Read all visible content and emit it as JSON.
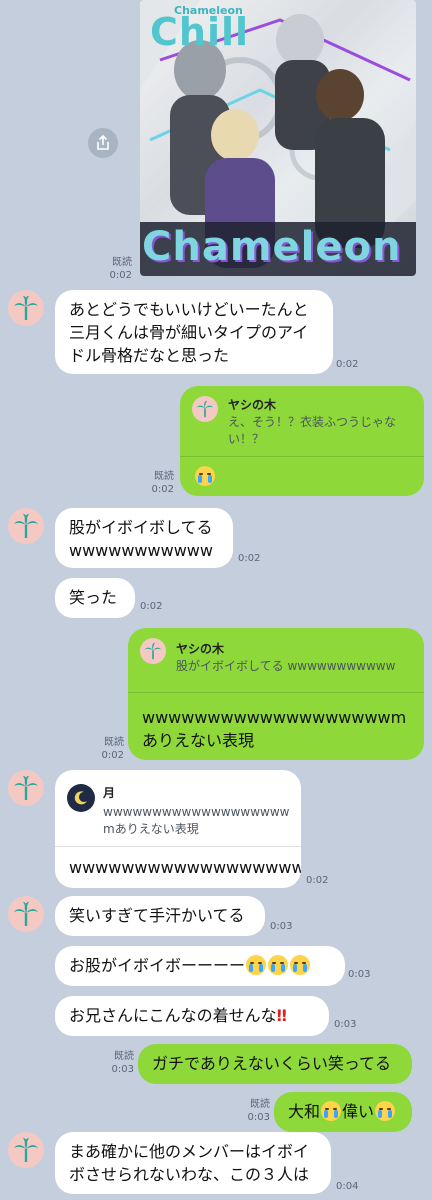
{
  "album": {
    "subtitle": "Chameleon",
    "title": "Chill",
    "bottom_text": "Chameleon",
    "read": "既読",
    "time": "0:02"
  },
  "share_icon": "share-icon",
  "messages": [
    {
      "text_lines": [
        "あとどうでもいいけどいーたんと",
        "三月くんは骨が細いタイプのアイ",
        "ドル骨格だなと思った"
      ],
      "time": "0:02"
    },
    {
      "reply_name": "ヤシの木",
      "reply_quote": [
        "え、そう！？衣装ふつうじゃな",
        "い！？"
      ],
      "read": "既読",
      "time": "0:02"
    },
    {
      "text_lines": [
        "股がイボイボしてる",
        "wwwwwwwwwww"
      ],
      "time": "0:02"
    },
    {
      "text": "笑った",
      "time": "0:02"
    },
    {
      "reply_name": "ヤシの木",
      "reply_quote": [
        "股がイボイボしてる wwwwwwwwwww"
      ],
      "text_lines": [
        "wwwwwwwwwwwwwwwwwwwm",
        "ありえない表現"
      ],
      "read": "既読",
      "time": "0:02"
    },
    {
      "reply_name": "月",
      "reply_quote": [
        "wwwwwwwwwwwwwwwwwww",
        "mありえない表現"
      ],
      "text": "wwwwwwwwwwwwwwwwww",
      "time": "0:02"
    },
    {
      "text": "笑いすぎて手汗かいてる",
      "time": "0:03"
    },
    {
      "text": "お股がイボイボーーーー",
      "time": "0:03"
    },
    {
      "text": "お兄さんにこんなの着せんな",
      "time": "0:03"
    },
    {
      "text": "ガチでありえないくらい笑ってる",
      "read": "既読",
      "time": "0:03"
    },
    {
      "text_a": "大和",
      "text_b": "偉い",
      "read": "既読",
      "time": "0:03"
    },
    {
      "text_lines": [
        "まあ確かに他のメンバーはイボイ",
        "ボさせられないわな、この３人は"
      ],
      "time": "0:04"
    }
  ],
  "colors": {
    "background": "#c4cedd",
    "sent": "#8ed83a",
    "received": "#ffffff",
    "avatar": "#f4c9c4",
    "palm": "#2aa79b"
  }
}
